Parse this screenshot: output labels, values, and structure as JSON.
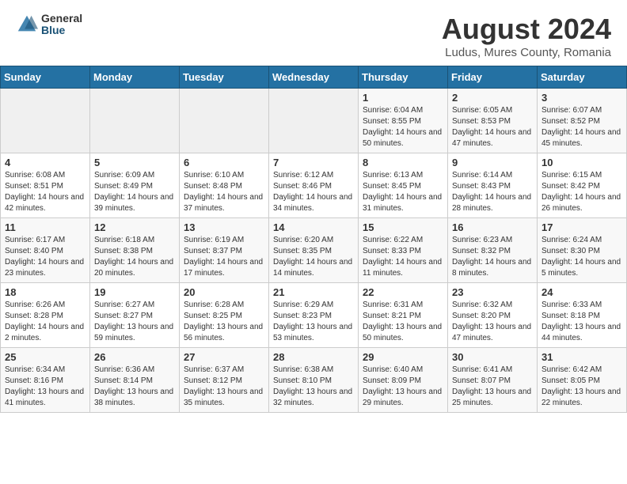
{
  "header": {
    "logo_general": "General",
    "logo_blue": "Blue",
    "month": "August 2024",
    "location": "Ludus, Mures County, Romania"
  },
  "weekdays": [
    "Sunday",
    "Monday",
    "Tuesday",
    "Wednesday",
    "Thursday",
    "Friday",
    "Saturday"
  ],
  "weeks": [
    [
      {
        "day": "",
        "info": ""
      },
      {
        "day": "",
        "info": ""
      },
      {
        "day": "",
        "info": ""
      },
      {
        "day": "",
        "info": ""
      },
      {
        "day": "1",
        "info": "Sunrise: 6:04 AM\nSunset: 8:55 PM\nDaylight: 14 hours and 50 minutes."
      },
      {
        "day": "2",
        "info": "Sunrise: 6:05 AM\nSunset: 8:53 PM\nDaylight: 14 hours and 47 minutes."
      },
      {
        "day": "3",
        "info": "Sunrise: 6:07 AM\nSunset: 8:52 PM\nDaylight: 14 hours and 45 minutes."
      }
    ],
    [
      {
        "day": "4",
        "info": "Sunrise: 6:08 AM\nSunset: 8:51 PM\nDaylight: 14 hours and 42 minutes."
      },
      {
        "day": "5",
        "info": "Sunrise: 6:09 AM\nSunset: 8:49 PM\nDaylight: 14 hours and 39 minutes."
      },
      {
        "day": "6",
        "info": "Sunrise: 6:10 AM\nSunset: 8:48 PM\nDaylight: 14 hours and 37 minutes."
      },
      {
        "day": "7",
        "info": "Sunrise: 6:12 AM\nSunset: 8:46 PM\nDaylight: 14 hours and 34 minutes."
      },
      {
        "day": "8",
        "info": "Sunrise: 6:13 AM\nSunset: 8:45 PM\nDaylight: 14 hours and 31 minutes."
      },
      {
        "day": "9",
        "info": "Sunrise: 6:14 AM\nSunset: 8:43 PM\nDaylight: 14 hours and 28 minutes."
      },
      {
        "day": "10",
        "info": "Sunrise: 6:15 AM\nSunset: 8:42 PM\nDaylight: 14 hours and 26 minutes."
      }
    ],
    [
      {
        "day": "11",
        "info": "Sunrise: 6:17 AM\nSunset: 8:40 PM\nDaylight: 14 hours and 23 minutes."
      },
      {
        "day": "12",
        "info": "Sunrise: 6:18 AM\nSunset: 8:38 PM\nDaylight: 14 hours and 20 minutes."
      },
      {
        "day": "13",
        "info": "Sunrise: 6:19 AM\nSunset: 8:37 PM\nDaylight: 14 hours and 17 minutes."
      },
      {
        "day": "14",
        "info": "Sunrise: 6:20 AM\nSunset: 8:35 PM\nDaylight: 14 hours and 14 minutes."
      },
      {
        "day": "15",
        "info": "Sunrise: 6:22 AM\nSunset: 8:33 PM\nDaylight: 14 hours and 11 minutes."
      },
      {
        "day": "16",
        "info": "Sunrise: 6:23 AM\nSunset: 8:32 PM\nDaylight: 14 hours and 8 minutes."
      },
      {
        "day": "17",
        "info": "Sunrise: 6:24 AM\nSunset: 8:30 PM\nDaylight: 14 hours and 5 minutes."
      }
    ],
    [
      {
        "day": "18",
        "info": "Sunrise: 6:26 AM\nSunset: 8:28 PM\nDaylight: 14 hours and 2 minutes."
      },
      {
        "day": "19",
        "info": "Sunrise: 6:27 AM\nSunset: 8:27 PM\nDaylight: 13 hours and 59 minutes."
      },
      {
        "day": "20",
        "info": "Sunrise: 6:28 AM\nSunset: 8:25 PM\nDaylight: 13 hours and 56 minutes."
      },
      {
        "day": "21",
        "info": "Sunrise: 6:29 AM\nSunset: 8:23 PM\nDaylight: 13 hours and 53 minutes."
      },
      {
        "day": "22",
        "info": "Sunrise: 6:31 AM\nSunset: 8:21 PM\nDaylight: 13 hours and 50 minutes."
      },
      {
        "day": "23",
        "info": "Sunrise: 6:32 AM\nSunset: 8:20 PM\nDaylight: 13 hours and 47 minutes."
      },
      {
        "day": "24",
        "info": "Sunrise: 6:33 AM\nSunset: 8:18 PM\nDaylight: 13 hours and 44 minutes."
      }
    ],
    [
      {
        "day": "25",
        "info": "Sunrise: 6:34 AM\nSunset: 8:16 PM\nDaylight: 13 hours and 41 minutes."
      },
      {
        "day": "26",
        "info": "Sunrise: 6:36 AM\nSunset: 8:14 PM\nDaylight: 13 hours and 38 minutes."
      },
      {
        "day": "27",
        "info": "Sunrise: 6:37 AM\nSunset: 8:12 PM\nDaylight: 13 hours and 35 minutes."
      },
      {
        "day": "28",
        "info": "Sunrise: 6:38 AM\nSunset: 8:10 PM\nDaylight: 13 hours and 32 minutes."
      },
      {
        "day": "29",
        "info": "Sunrise: 6:40 AM\nSunset: 8:09 PM\nDaylight: 13 hours and 29 minutes."
      },
      {
        "day": "30",
        "info": "Sunrise: 6:41 AM\nSunset: 8:07 PM\nDaylight: 13 hours and 25 minutes."
      },
      {
        "day": "31",
        "info": "Sunrise: 6:42 AM\nSunset: 8:05 PM\nDaylight: 13 hours and 22 minutes."
      }
    ]
  ]
}
